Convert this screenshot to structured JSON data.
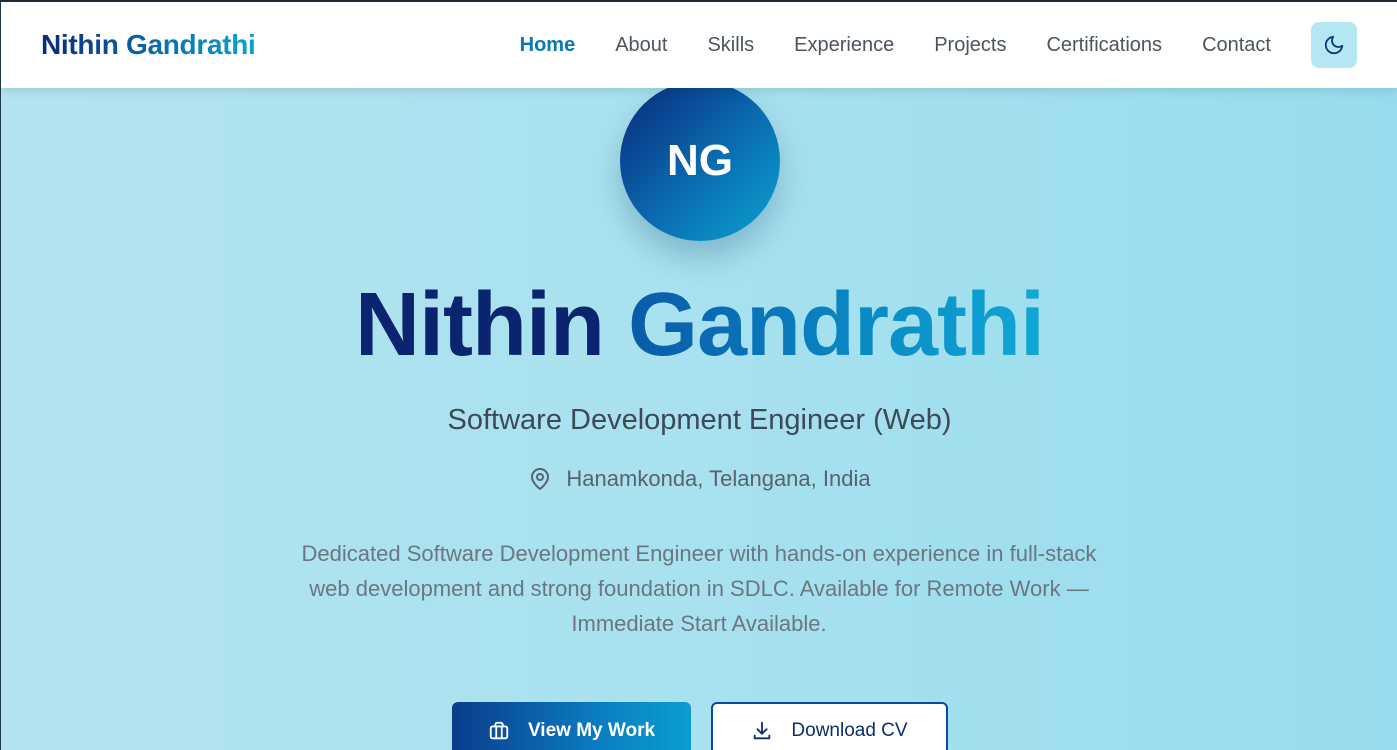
{
  "navbar": {
    "brand": "Nithin Gandrathi",
    "links": [
      {
        "label": "Home",
        "active": true
      },
      {
        "label": "About"
      },
      {
        "label": "Skills"
      },
      {
        "label": "Experience"
      },
      {
        "label": "Projects"
      },
      {
        "label": "Certifications"
      },
      {
        "label": "Contact"
      }
    ],
    "theme_toggle_icon": "moon-icon"
  },
  "hero": {
    "avatar_initials": "NG",
    "first_name": "Nithin",
    "last_name": "Gandrathi",
    "role": "Software Development Engineer (Web)",
    "location": "Hanamkonda, Telangana, India",
    "location_icon": "map-pin-icon",
    "description": "Dedicated Software Development Engineer with hands-on experience in full-stack web development and strong foundation in SDLC. Available for Remote Work — Immediate Start Available.",
    "primary_button": {
      "label": "View My Work",
      "icon": "briefcase-icon"
    },
    "secondary_button": {
      "label": "Download CV",
      "icon": "download-icon"
    }
  },
  "colors": {
    "accent": "#0a78b4",
    "brand_dark": "#0a2470",
    "brand_light": "#0aa3d1",
    "hero_bg": "#a8e1ef"
  }
}
